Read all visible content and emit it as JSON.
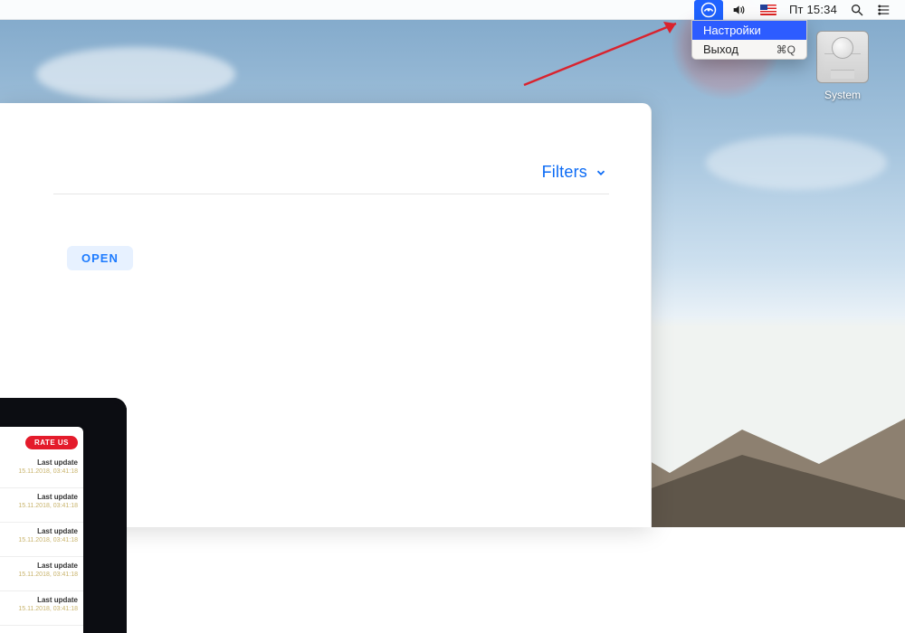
{
  "menubar": {
    "clock": "Пт 15:34",
    "dropdown": {
      "settings": "Настройки",
      "quit": "Выход",
      "quit_shortcut": "⌘Q"
    }
  },
  "desktop_icon": {
    "label": "System"
  },
  "app": {
    "filters_label": "Filters",
    "open_badge": "OPEN",
    "preview": {
      "rate_us": "RATE US",
      "row_title": "Last update",
      "row_subtitle": "15.11.2018, 03:41:18"
    }
  },
  "colors": {
    "accent_blue": "#0a6af5",
    "menu_highlight": "#2d5cff"
  }
}
